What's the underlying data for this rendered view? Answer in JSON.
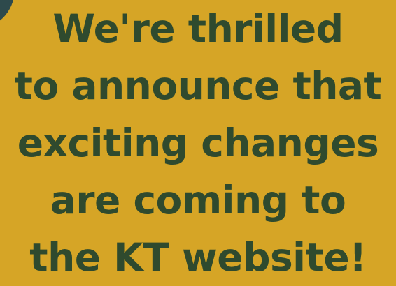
{
  "announcement": {
    "lines": [
      "We're thrilled",
      "to announce that",
      "exciting changes",
      "are coming to",
      "the KT website!"
    ]
  },
  "colors": {
    "background": "#D6A526",
    "text": "#2F4A2E",
    "corner_shape": "#2E4A4C"
  }
}
